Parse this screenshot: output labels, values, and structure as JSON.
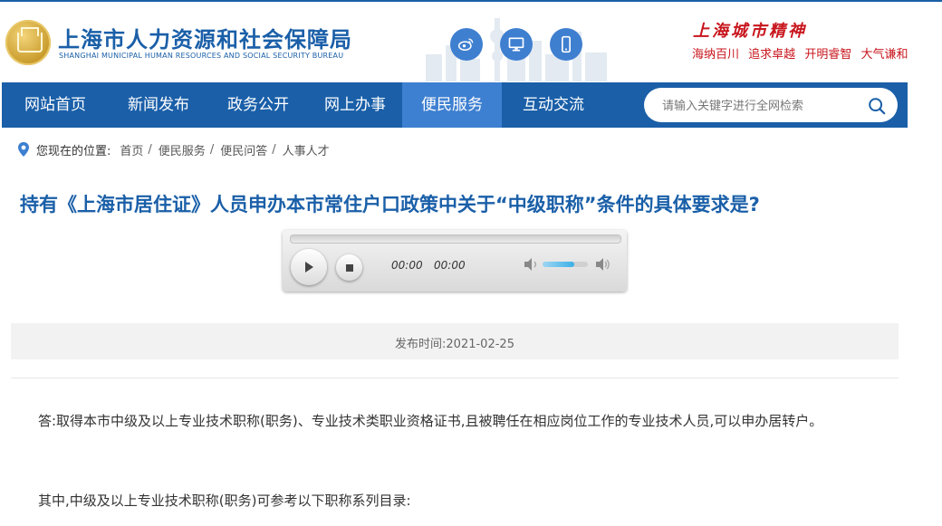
{
  "header": {
    "logo_cn": "上海市人力资源和社会保障局",
    "logo_en": "SHANGHAI MUNICIPAL HUMAN RESOURCES AND SOCIAL SECURITY BUREAU",
    "social": [
      "weibo-icon",
      "desktop-icon",
      "mobile-icon"
    ],
    "spirit_title": "上海城市精神",
    "spirit_items": [
      "海纳百川",
      "追求卓越",
      "开明睿智",
      "大气谦和"
    ]
  },
  "nav": {
    "items": [
      "网站首页",
      "新闻发布",
      "政务公开",
      "网上办事",
      "便民服务",
      "互动交流"
    ],
    "active": "便民服务",
    "search_placeholder": "请输入关键字进行全网检索"
  },
  "breadcrumb": {
    "label": "您现在的位置:",
    "items": [
      "首页",
      "便民服务",
      "便民问答",
      "人事人才"
    ]
  },
  "article": {
    "title": "持有《上海市居住证》人员申办本市常住户口政策中关于“中级职称”条件的具体要求是?",
    "publish": "发布时间:2021-02-25",
    "paragraphs": [
      "答:取得本市中级及以上专业技术职称(职务)、专业技术类职业资格证书,且被聘任在相应岗位工作的专业技术人员,可以申办居转户。",
      "其中,中级及以上专业技术职称(职务)可参考以下职称系列目录:"
    ]
  },
  "player": {
    "current_time": "00:00",
    "duration": "00:00",
    "volume": 0.7
  },
  "colors": {
    "brand_blue": "#1a5fa8",
    "nav_active": "#3d7fd0",
    "spirit_red": "#c8161d"
  }
}
